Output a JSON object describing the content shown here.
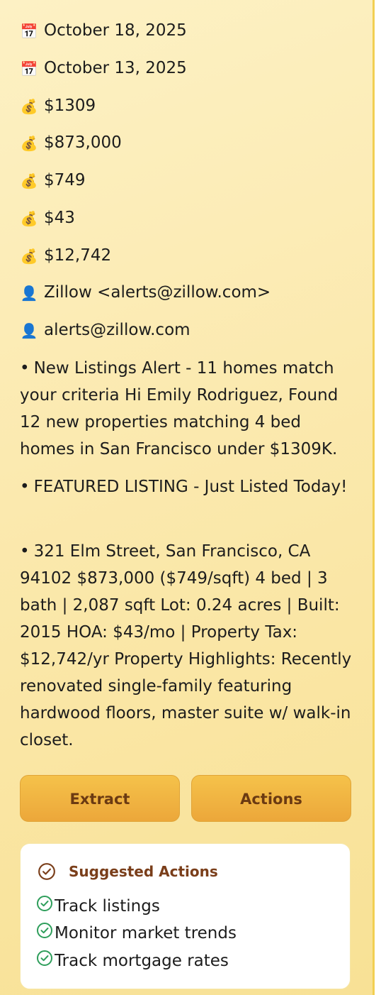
{
  "meta": [
    {
      "icon": "calendar-icon",
      "glyph": "📅",
      "text": "October 18, 2025"
    },
    {
      "icon": "calendar-icon",
      "glyph": "📅",
      "text": "October 13, 2025"
    },
    {
      "icon": "money-bag-icon",
      "glyph": "💰",
      "text": "$1309"
    },
    {
      "icon": "money-bag-icon",
      "glyph": "💰",
      "text": "$873,000"
    },
    {
      "icon": "money-bag-icon",
      "glyph": "💰",
      "text": "$749"
    },
    {
      "icon": "money-bag-icon",
      "glyph": "💰",
      "text": "$43"
    },
    {
      "icon": "money-bag-icon",
      "glyph": "💰",
      "text": "$12,742"
    },
    {
      "icon": "person-icon",
      "glyph": "👤",
      "text": "Zillow <alerts@zillow.com>"
    },
    {
      "icon": "person-icon",
      "glyph": "👤",
      "text": "alerts@zillow.com"
    }
  ],
  "bullets": [
    {
      "dot": "•",
      "text": "New Listings Alert - 11 homes match your criteria Hi Emily Rodriguez, Found 12 new properties matching 4 bed homes in San Francisco under $1309K."
    },
    {
      "dot": "•",
      "text": "FEATURED LISTING - Just Listed Today!"
    },
    {
      "dot": "•",
      "text": "321 Elm Street, San Francisco, CA 94102 $873,000 ($749/sqft) 4 bed | 3 bath | 2,087 sqft Lot: 0.24 acres | Built: 2015 HOA: $43/mo | Property Tax: $12,742/yr Property Highlights: Recently renovated single-family featuring hardwood floors, master suite w/ walk-in closet."
    }
  ],
  "buttons": {
    "extract_label": "Extract",
    "actions_label": "Actions"
  },
  "suggested": {
    "title": "Suggested Actions",
    "items": [
      "Track listings",
      "Monitor market trends",
      "Track mortgage rates"
    ]
  },
  "colors": {
    "panel_bg": "#fbe9ae",
    "panel_border": "#f2cf52",
    "button": "#f0b442",
    "button_text": "#6b3a12",
    "heading_accent": "#7a3e1a",
    "check_green": "#2e9e5b"
  }
}
